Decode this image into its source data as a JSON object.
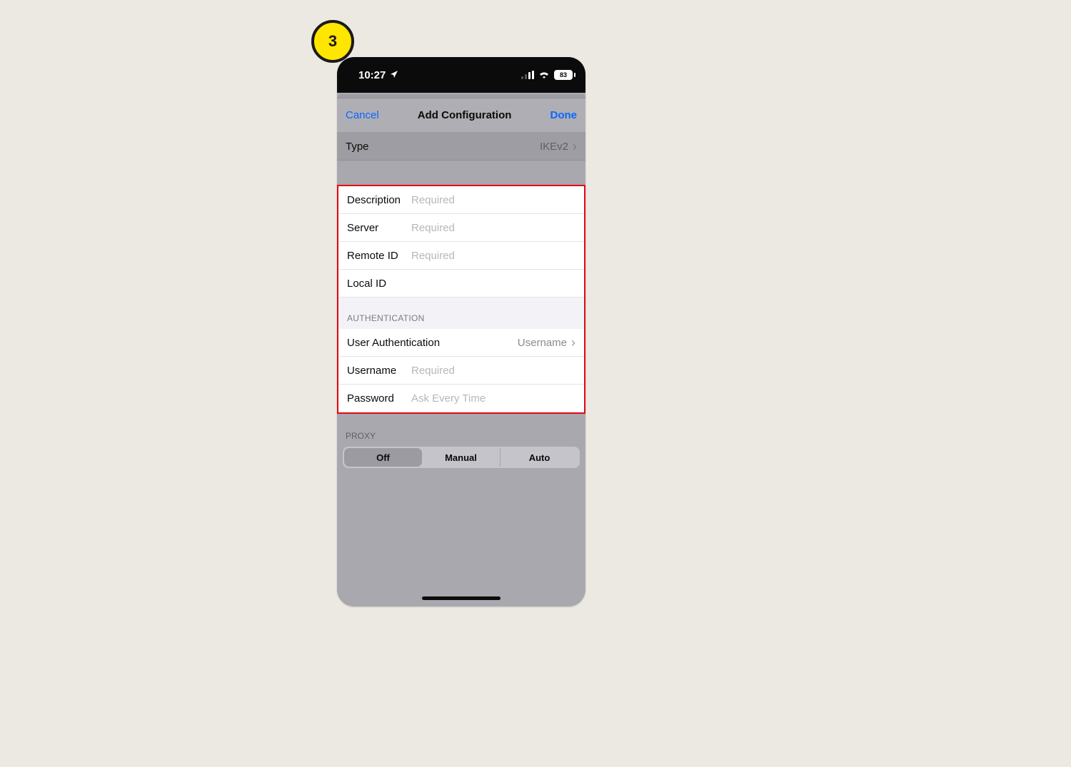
{
  "annotation": {
    "step_number": "3"
  },
  "statusbar": {
    "time": "10:27",
    "battery": "83"
  },
  "nav": {
    "cancel": "Cancel",
    "title": "Add Configuration",
    "done": "Done"
  },
  "type_row": {
    "label": "Type",
    "value": "IKEv2"
  },
  "fields": {
    "description": {
      "label": "Description",
      "placeholder": "Required"
    },
    "server": {
      "label": "Server",
      "placeholder": "Required"
    },
    "remote_id": {
      "label": "Remote ID",
      "placeholder": "Required"
    },
    "local_id": {
      "label": "Local ID",
      "placeholder": ""
    }
  },
  "auth": {
    "section": "AUTHENTICATION",
    "user_auth": {
      "label": "User Authentication",
      "value": "Username"
    },
    "username": {
      "label": "Username",
      "placeholder": "Required"
    },
    "password": {
      "label": "Password",
      "placeholder": "Ask Every Time"
    }
  },
  "proxy": {
    "section": "PROXY",
    "options": [
      "Off",
      "Manual",
      "Auto"
    ],
    "selected": "Off"
  }
}
